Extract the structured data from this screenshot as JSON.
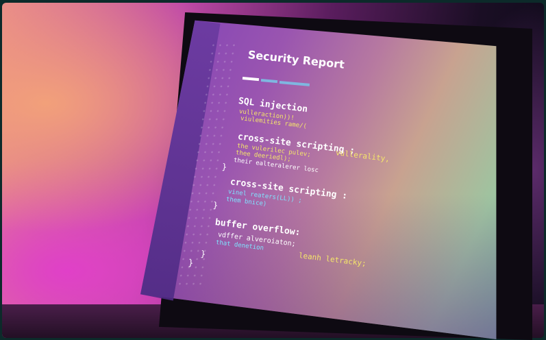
{
  "scene": {
    "colors": {
      "background_warm": "#f2a07a",
      "background_magenta": "#e040c8",
      "screen_purple": "#7c3fb8",
      "screen_green": "#9ec4a0",
      "bezel": "#0e0a12"
    }
  },
  "screen": {
    "title": "Security Report",
    "sections": [
      {
        "heading": "SQL injection",
        "lines": [
          "vulleraction))!",
          "viulemities rame/("
        ]
      },
      {
        "heading": "cross-site scripting ;",
        "heading_accent": "vullerality,",
        "lines": [
          "the vulerilec pulev;",
          "thee deeriedl);",
          "their ealteralerer losc"
        ],
        "close": "}"
      },
      {
        "heading": "cross-site scripting :",
        "lines": [
          "vinel reaters(LL)) ;",
          "them bnice)"
        ],
        "close": "}"
      },
      {
        "heading": "buffer overflow:",
        "lines": [
          "vdffer alveroiaton;",
          "that denetion"
        ],
        "line_accent": "leanh letracky;",
        "close": "}"
      }
    ]
  }
}
